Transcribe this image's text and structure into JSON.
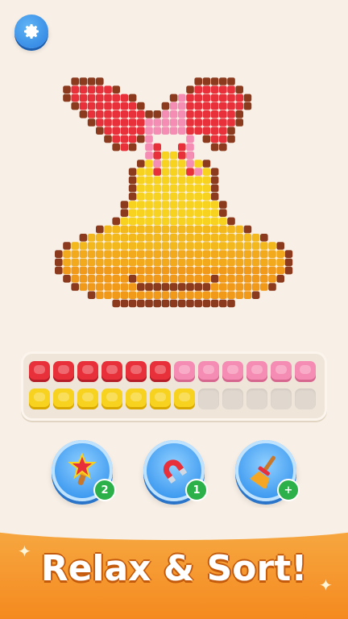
{
  "app": {
    "tagline": "Relax & Sort!"
  },
  "settings": {
    "icon": "gear-icon"
  },
  "artwork": {
    "subject": "bell-with-bow",
    "palette": {
      "red": "#e8303a",
      "pink": "#f58cb3",
      "yellow": "#f7d21e",
      "orange": "#f2a91c",
      "outline": "#8b3a1e"
    }
  },
  "tray": {
    "row1": [
      "red",
      "red",
      "red",
      "red",
      "red",
      "red",
      "pink",
      "pink",
      "pink",
      "pink",
      "pink",
      "pink"
    ],
    "row2": [
      "yellow",
      "yellow",
      "yellow",
      "yellow",
      "yellow",
      "yellow",
      "yellow",
      "empty",
      "empty",
      "empty",
      "empty",
      "empty"
    ]
  },
  "boosters": [
    {
      "name": "magic-wand",
      "icon": "magic-wand-icon",
      "count": "2"
    },
    {
      "name": "magnet",
      "icon": "magnet-icon",
      "count": "1"
    },
    {
      "name": "broom",
      "icon": "broom-icon",
      "count": "+"
    }
  ]
}
